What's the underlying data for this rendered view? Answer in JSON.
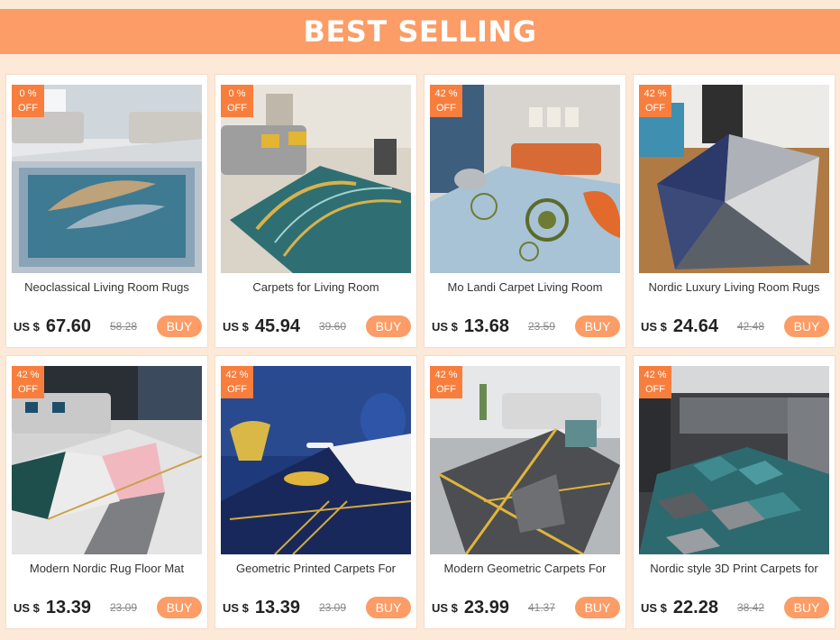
{
  "header": {
    "title": "BEST SELLING"
  },
  "colors": {
    "banner": "#fc9c66",
    "badge": "#f77e3d",
    "buy": "#fc9c66",
    "background": "#fde9d8"
  },
  "products": [
    {
      "discount": "0 %",
      "off": "OFF",
      "title": "Neoclassical Living Room Rugs",
      "currency": "US $",
      "price": "67.60",
      "old_price": "58.28",
      "buy": "BUY",
      "image": "living-room-feather-rug"
    },
    {
      "discount": "0 %",
      "off": "OFF",
      "title": "Carpets for Living Room",
      "currency": "US $",
      "price": "45.94",
      "old_price": "39.60",
      "buy": "BUY",
      "image": "living-room-teal-gold-rug"
    },
    {
      "discount": "42 %",
      "off": "OFF",
      "title": "Mo Landi Carpet Living Room",
      "currency": "US $",
      "price": "13.68",
      "old_price": "23.59",
      "buy": "BUY",
      "image": "circles-rug-orange-sofa"
    },
    {
      "discount": "42 %",
      "off": "OFF",
      "title": "Nordic Luxury Living Room Rugs",
      "currency": "US $",
      "price": "24.64",
      "old_price": "42.48",
      "buy": "BUY",
      "image": "3d-geometric-rug"
    },
    {
      "discount": "42 %",
      "off": "OFF",
      "title": "Modern Nordic Rug Floor Mat",
      "currency": "US $",
      "price": "13.39",
      "old_price": "23.09",
      "buy": "BUY",
      "image": "pink-marble-geometric-rug"
    },
    {
      "discount": "42 %",
      "off": "OFF",
      "title": "Geometric Printed Carpets For",
      "currency": "US $",
      "price": "13.39",
      "old_price": "23.09",
      "buy": "BUY",
      "image": "navy-gold-line-rug"
    },
    {
      "discount": "42 %",
      "off": "OFF",
      "title": "Modern Geometric Carpets For",
      "currency": "US $",
      "price": "23.99",
      "old_price": "41.37",
      "buy": "BUY",
      "image": "grey-gold-triangle-rug"
    },
    {
      "discount": "42 %",
      "off": "OFF",
      "title": "Nordic style 3D Print Carpets for",
      "currency": "US $",
      "price": "22.28",
      "old_price": "38.42",
      "buy": "BUY",
      "image": "kitchen-hexagon-rug"
    }
  ]
}
